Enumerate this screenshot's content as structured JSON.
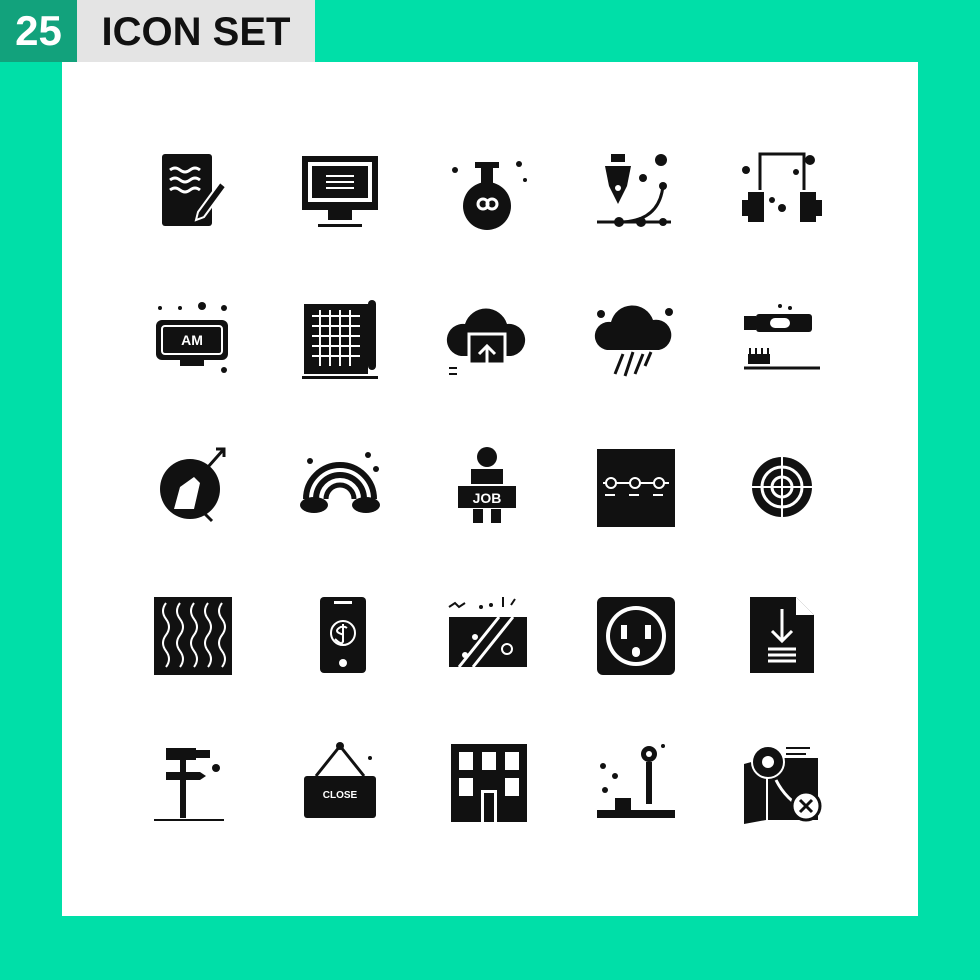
{
  "header": {
    "count": "25",
    "title": "ICON SET"
  },
  "colors": {
    "background": "#00dfa8",
    "count_box": "#12a27c",
    "title_box": "#e4e4e4",
    "icon": "#111111"
  },
  "icons": [
    {
      "name": "document-edit-icon"
    },
    {
      "name": "computer-monitor-icon"
    },
    {
      "name": "potion-flask-icon"
    },
    {
      "name": "pen-tool-bezier-icon"
    },
    {
      "name": "headphones-icon"
    },
    {
      "name": "alarm-clock-am-icon",
      "label": "AM"
    },
    {
      "name": "blueprint-icon"
    },
    {
      "name": "cloud-upload-folder-icon"
    },
    {
      "name": "rain-cloud-icon"
    },
    {
      "name": "toothpaste-brush-icon"
    },
    {
      "name": "horse-mars-icon"
    },
    {
      "name": "rainbow-icon"
    },
    {
      "name": "job-seeker-icon",
      "label": "JOB"
    },
    {
      "name": "timeline-icon"
    },
    {
      "name": "target-icon"
    },
    {
      "name": "wave-pattern-icon"
    },
    {
      "name": "mobile-dollar-icon"
    },
    {
      "name": "gift-card-icon"
    },
    {
      "name": "power-socket-icon"
    },
    {
      "name": "file-download-icon"
    },
    {
      "name": "hammer-pencil-signpost-icon"
    },
    {
      "name": "close-sign-icon",
      "label": "CLOSE"
    },
    {
      "name": "building-icon"
    },
    {
      "name": "joystick-icon"
    },
    {
      "name": "map-location-cancel-icon"
    }
  ]
}
